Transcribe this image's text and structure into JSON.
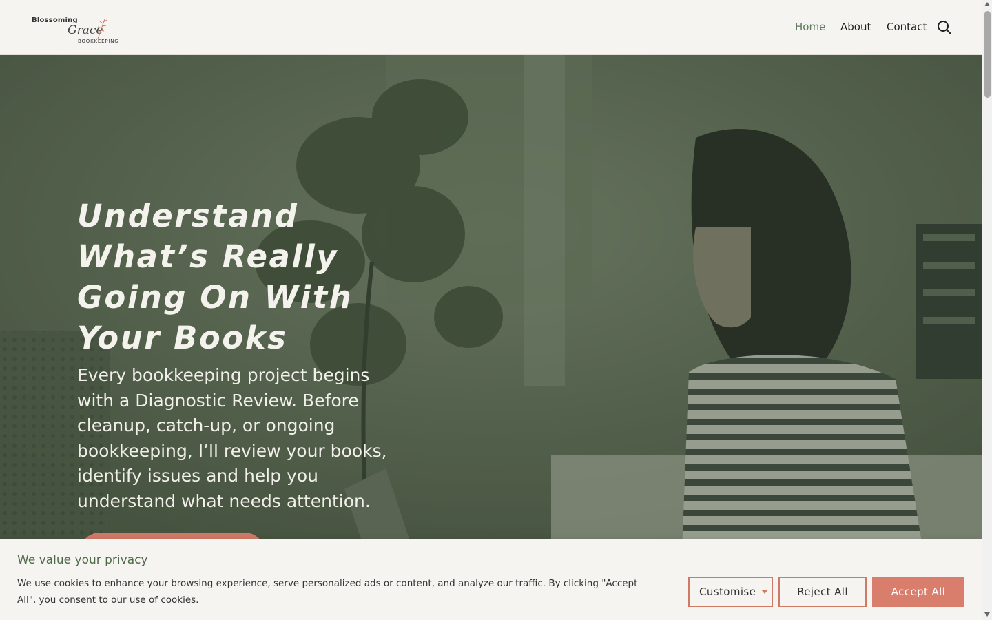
{
  "brand": {
    "logo_top": "Blossoming",
    "logo_script": "Grace",
    "logo_bottom": "BOOKKEEPING"
  },
  "nav": {
    "items": [
      {
        "label": "Home",
        "active": true
      },
      {
        "label": "About",
        "active": false
      },
      {
        "label": "Contact",
        "active": false
      }
    ],
    "search_icon": "search-icon"
  },
  "hero": {
    "title": "Understand What’s Really Going On With Your Books",
    "body": "Every bookkeeping project begins with a Diagnostic Review. Before cleanup, catch-up, or ongoing bookkeeping, I’ll review your books, identify issues and help you understand what needs attention."
  },
  "cookie": {
    "title": "We value your privacy",
    "text": "We use cookies to enhance your browsing experience, serve personalized ads or content, and analyze our traffic. By clicking \"Accept All\", you consent to our use of cookies.",
    "customise_label": "Customise",
    "reject_label": "Reject All",
    "accept_label": "Accept All"
  },
  "colors": {
    "accent": "#d07a66",
    "nav_active": "#5d7a5a",
    "hero_overlay": "#4c5a48",
    "background": "#f6f4f0"
  }
}
